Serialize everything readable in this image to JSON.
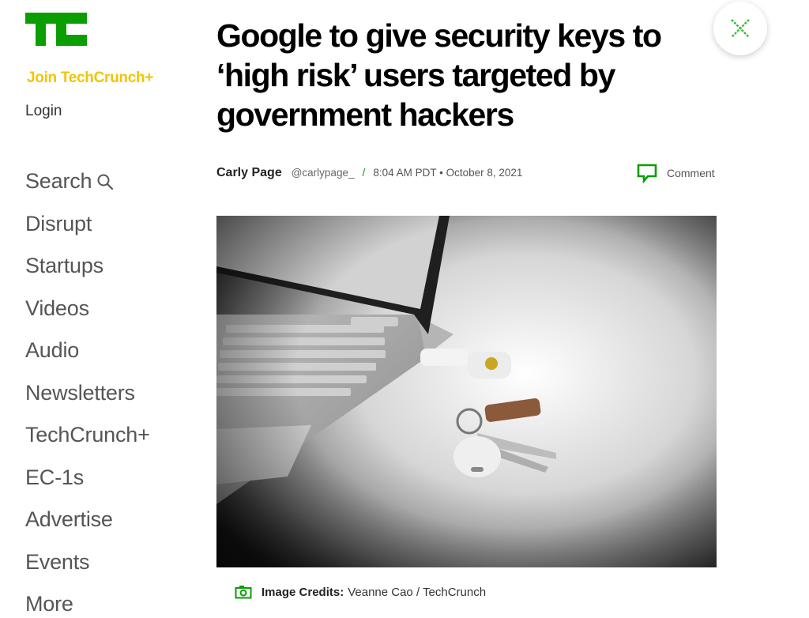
{
  "brand": {
    "logo_text": "TC",
    "color": "#0a9e01"
  },
  "sidebar": {
    "join_label": "Join TechCrunch+",
    "login_label": "Login",
    "items": [
      {
        "label": "Search",
        "icon": "search-icon"
      },
      {
        "label": "Disrupt"
      },
      {
        "label": "Startups"
      },
      {
        "label": "Videos"
      },
      {
        "label": "Audio"
      },
      {
        "label": "Newsletters"
      },
      {
        "label": "TechCrunch+"
      },
      {
        "label": "EC-1s"
      },
      {
        "label": "Advertise"
      },
      {
        "label": "Events"
      },
      {
        "label": "More"
      }
    ]
  },
  "article": {
    "title": "Google to give security keys to ‘high risk’ users targeted by government hackers",
    "author": "Carly Page",
    "handle": "@carlypage_",
    "separator": "/",
    "timestamp": "8:04 AM PDT • October 8, 2021",
    "comment_label": "Comment",
    "image_credit_label": "Image Credits:",
    "image_credit_value": "Veanne Cao / TechCrunch"
  },
  "colors": {
    "accent": "#0a9e01",
    "join": "#f2c500"
  }
}
